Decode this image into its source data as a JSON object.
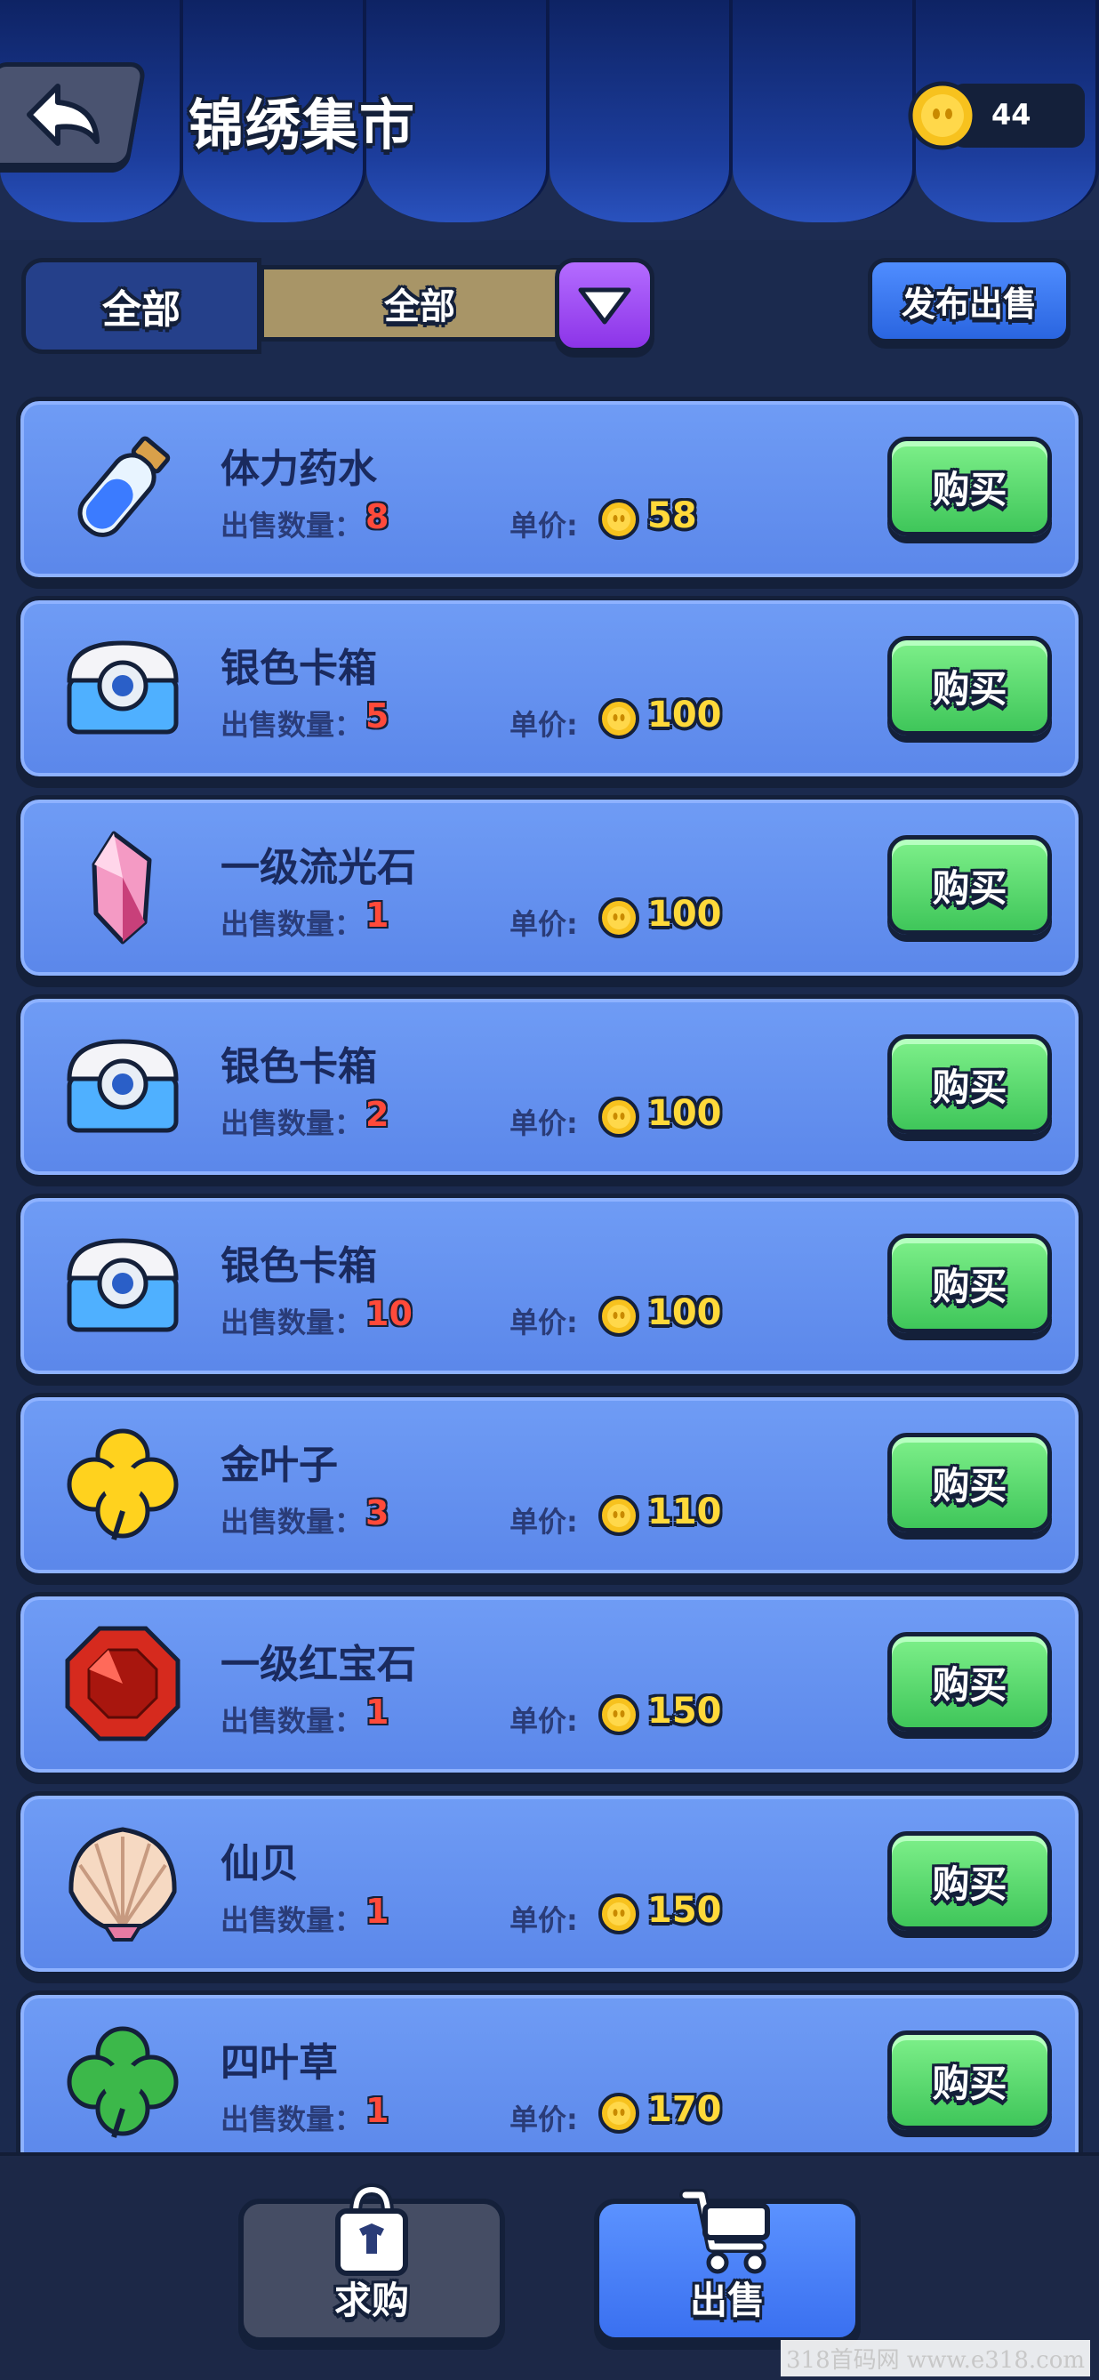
{
  "header": {
    "title": "锦绣集市",
    "coin_count": "44"
  },
  "filter": {
    "category": "全部",
    "subcategory": "全部",
    "sell_post_label": "发布出售"
  },
  "labels": {
    "qty": "出售数量：",
    "price": "单价:",
    "buy": "购买"
  },
  "items": [
    {
      "name": "体力药水",
      "qty": "8",
      "price": "58",
      "icon": "potion-icon"
    },
    {
      "name": "银色卡箱",
      "qty": "5",
      "price": "100",
      "icon": "silver-chest-icon"
    },
    {
      "name": "一级流光石",
      "qty": "1",
      "price": "100",
      "icon": "pink-crystal-icon"
    },
    {
      "name": "银色卡箱",
      "qty": "2",
      "price": "100",
      "icon": "silver-chest-icon"
    },
    {
      "name": "银色卡箱",
      "qty": "10",
      "price": "100",
      "icon": "silver-chest-icon"
    },
    {
      "name": "金叶子",
      "qty": "3",
      "price": "110",
      "icon": "gold-leaf-icon"
    },
    {
      "name": "一级红宝石",
      "qty": "1",
      "price": "150",
      "icon": "ruby-icon"
    },
    {
      "name": "仙贝",
      "qty": "1",
      "price": "150",
      "icon": "shell-icon"
    },
    {
      "name": "四叶草",
      "qty": "1",
      "price": "170",
      "icon": "clover-icon"
    }
  ],
  "tabs": {
    "buy_request": "求购",
    "sell": "出售"
  },
  "watermark": "318首码网 www.e318.com",
  "colors": {
    "row_bg": "#6f9cf5",
    "buy_button": "#3fc65a",
    "dropdown": "#8c34e8",
    "qty_red": "#ff4a3a",
    "price_gold": "#ffd93a"
  }
}
